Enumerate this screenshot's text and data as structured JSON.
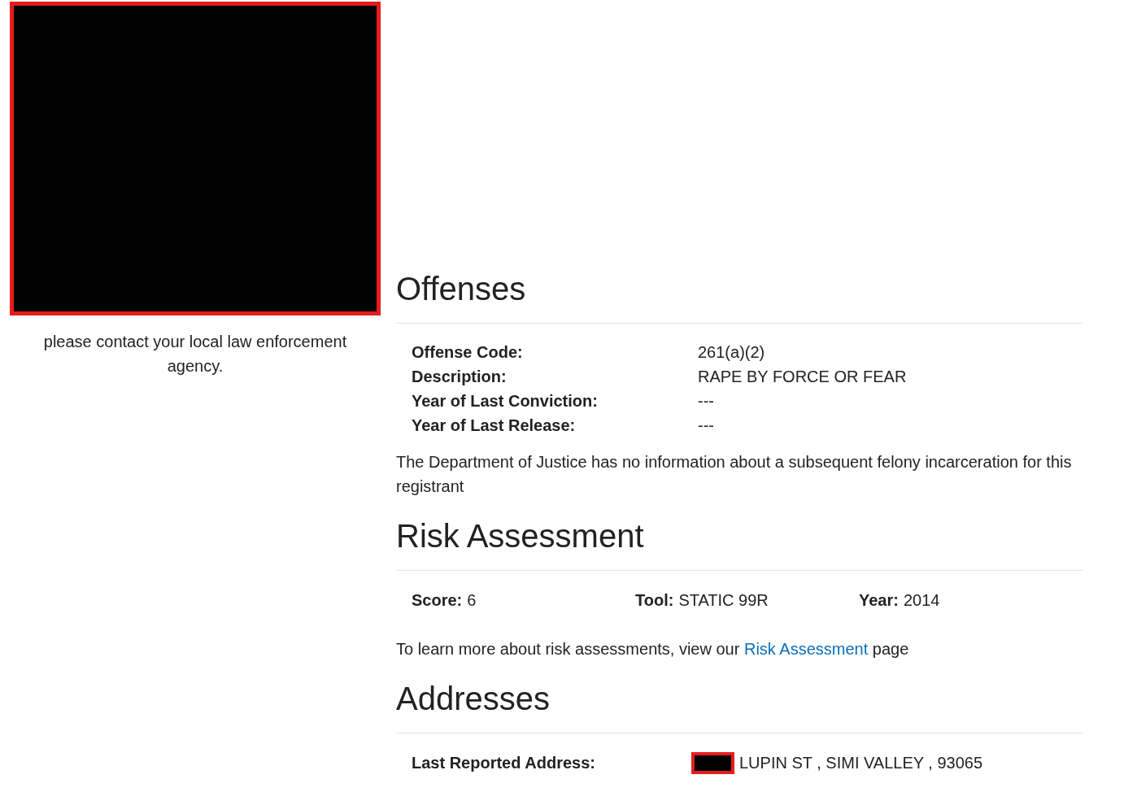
{
  "sidebar": {
    "notice": "please contact your local law enforcement agency."
  },
  "offenses": {
    "heading": "Offenses",
    "fields": [
      {
        "label": "Offense Code:",
        "value": "261(a)(2)"
      },
      {
        "label": "Description:",
        "value": "RAPE BY FORCE OR FEAR"
      },
      {
        "label": "Year of Last Conviction:",
        "value": "---"
      },
      {
        "label": "Year of Last Release:",
        "value": "---"
      }
    ],
    "note": "The Department of Justice has no information about a subsequent felony incarceration for this registrant"
  },
  "risk_assessment": {
    "heading": "Risk Assessment",
    "items": [
      {
        "label": "Score:",
        "value": "6"
      },
      {
        "label": "Tool:",
        "value": "STATIC 99R"
      },
      {
        "label": "Year:",
        "value": "2014"
      }
    ],
    "note_before": "To learn more about risk assessments, view our",
    "link": "Risk Assessment",
    "note_after": "page"
  },
  "addresses": {
    "heading": "Addresses",
    "label": "Last Reported Address:",
    "value": "LUPIN ST , SIMI VALLEY , 93065"
  }
}
